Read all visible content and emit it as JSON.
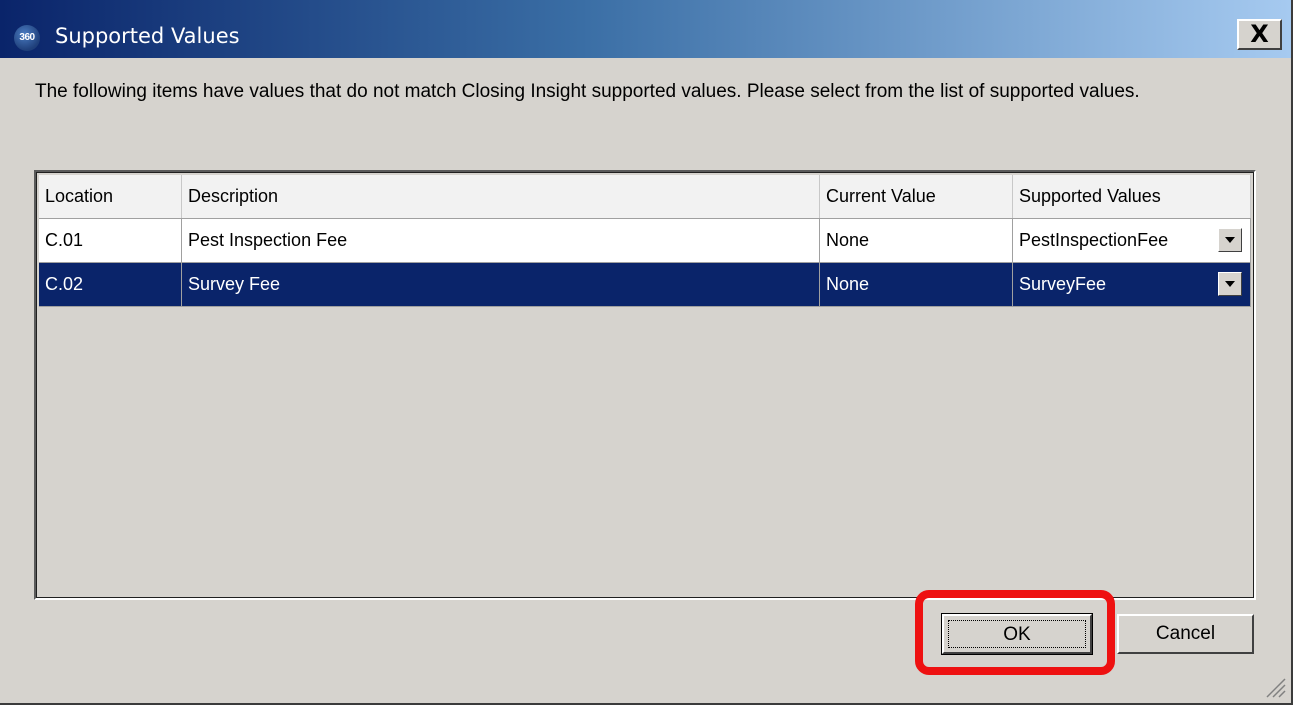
{
  "window": {
    "title": "Supported Values",
    "logo_text": "360",
    "close_label": "X"
  },
  "message": "The following items have values that do not match Closing Insight supported values. Please select from the list of supported values.",
  "table": {
    "columns": [
      "Location",
      "Description",
      "Current Value",
      "Supported Values"
    ],
    "rows": [
      {
        "location": "C.01",
        "description": "Pest Inspection Fee",
        "current_value": "None",
        "supported_value": "PestInspectionFee",
        "selected": false
      },
      {
        "location": "C.02",
        "description": "Survey Fee",
        "current_value": "None",
        "supported_value": "SurveyFee",
        "selected": true
      }
    ]
  },
  "buttons": {
    "ok_label": "OK",
    "cancel_label": "Cancel"
  },
  "colors": {
    "selection": "#0a246a",
    "annotation": "#ee1111",
    "dialog_bg": "#d6d3ce"
  }
}
